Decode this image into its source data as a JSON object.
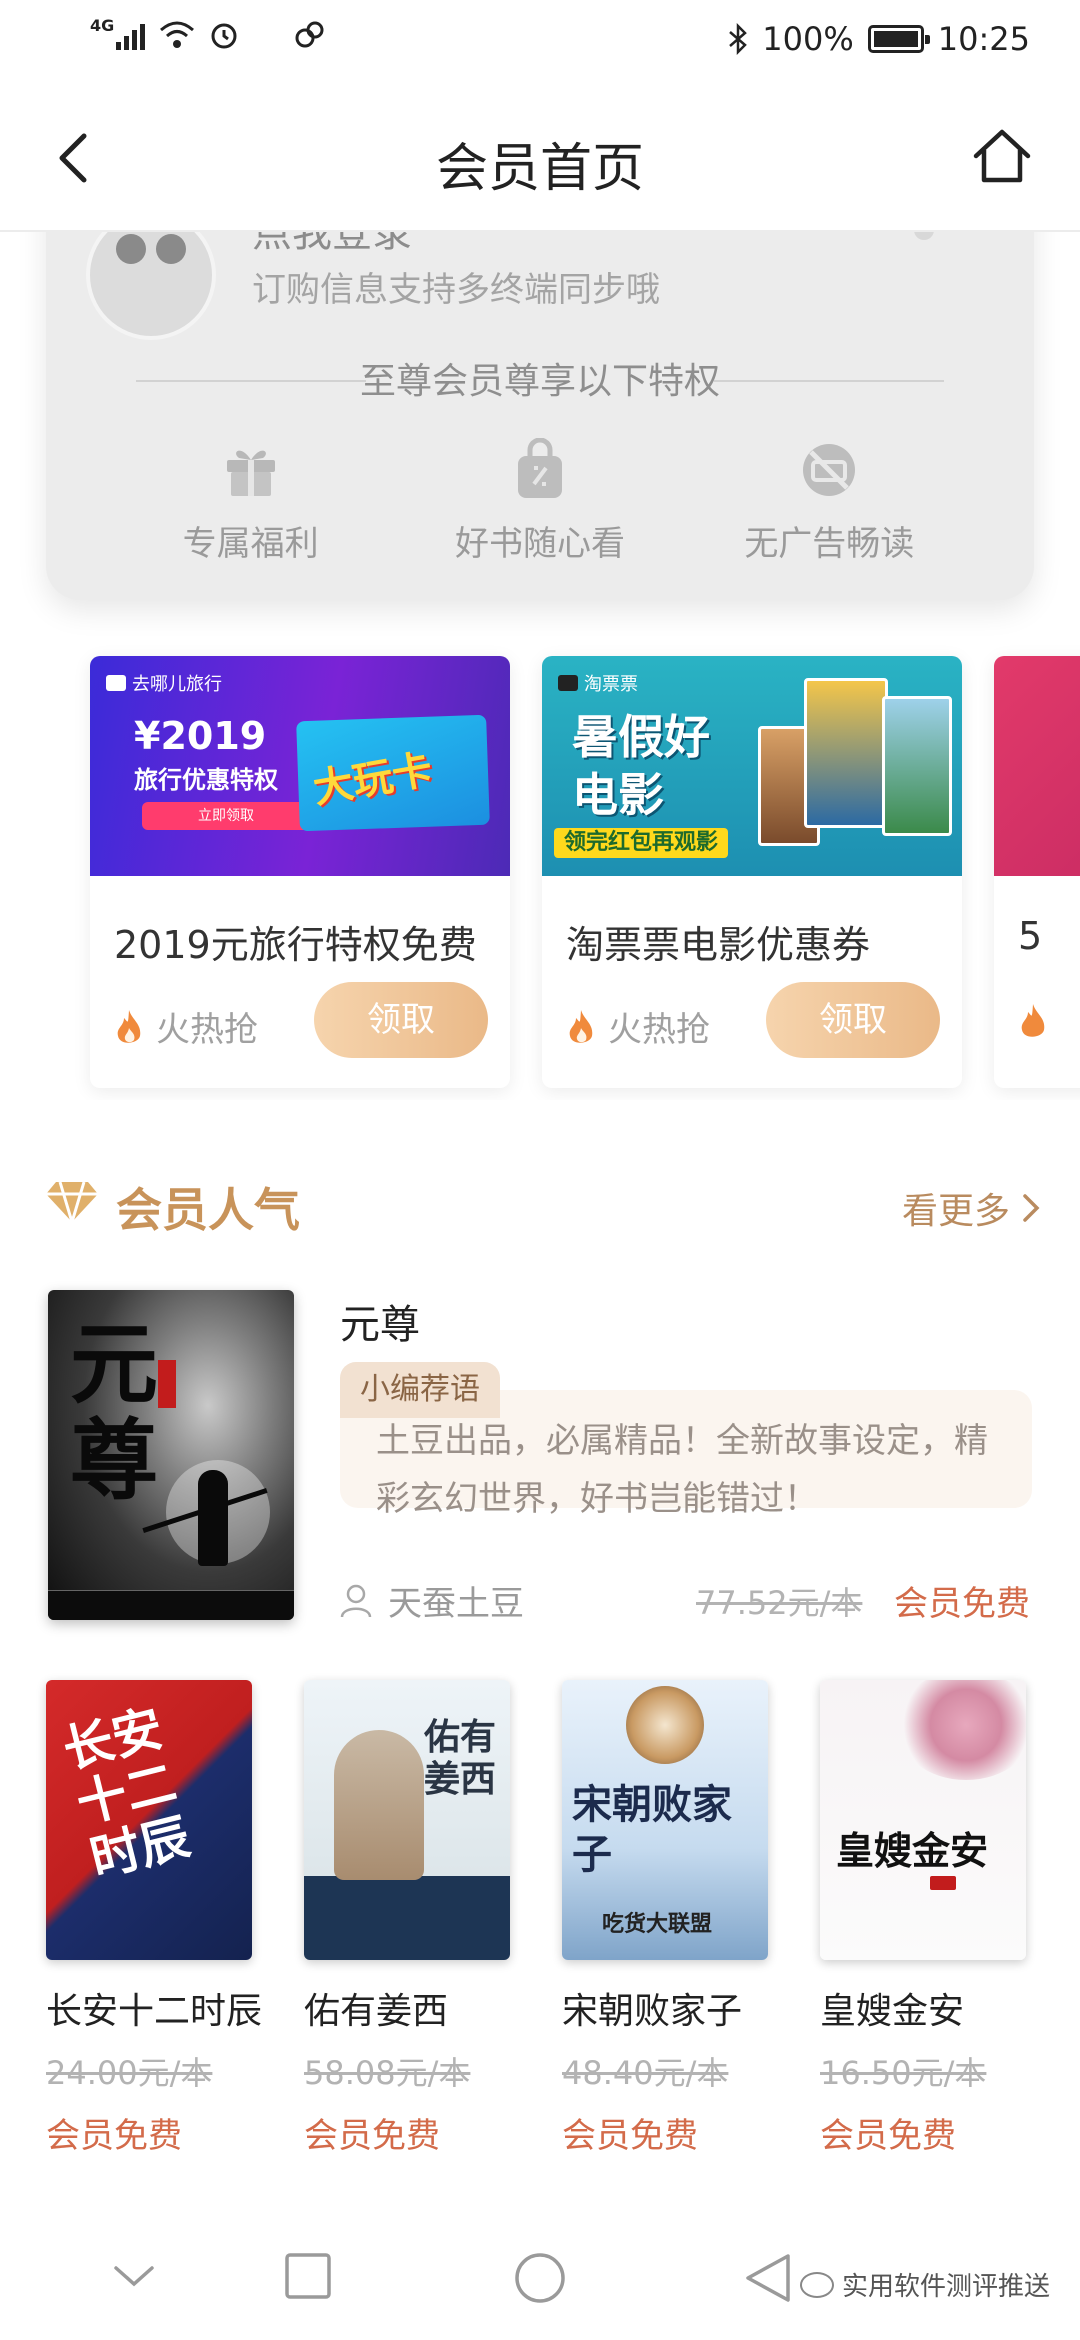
{
  "status_bar": {
    "network": "4G",
    "battery": "100%",
    "time": "10:25"
  },
  "nav": {
    "title": "会员首页"
  },
  "member_card": {
    "name": "点我登录",
    "subtitle": "订购信息支持多终端同步哦",
    "privileges_title": "至尊会员尊享以下特权",
    "privileges": [
      {
        "icon": "gift-icon",
        "label": "专属福利"
      },
      {
        "icon": "book-bag-icon",
        "label": "好书随心看"
      },
      {
        "icon": "no-ads-icon",
        "label": "无广告畅读"
      }
    ]
  },
  "coupons": [
    {
      "title": "2019元旅行特权免费",
      "hot_label": "火热抢",
      "button": "领取",
      "banner": {
        "brand": "去哪儿旅行",
        "headline": "¥2019",
        "subline": "旅行优惠特权",
        "cta": "立即领取",
        "card_text": "大玩卡"
      }
    },
    {
      "title": "淘票票电影优惠券",
      "hot_label": "火热抢",
      "button": "领取",
      "banner": {
        "brand": "淘票票",
        "headline": "暑假好电影",
        "tag": "领完红包再观影"
      }
    },
    {
      "title": "5",
      "hot_label": "",
      "button": ""
    }
  ],
  "section": {
    "title": "会员人气",
    "more": "看更多"
  },
  "featured": {
    "title": "元尊",
    "tag": "小编荐语",
    "recommendation": "土豆出品，必属精品！全新故事设定，精彩玄幻世界，好书岂能错过！",
    "author": "天蚕土豆",
    "price": "77.52元/本",
    "free_label": "会员免费",
    "cover_text": "元尊"
  },
  "books": [
    {
      "title": "长安十二时辰",
      "price": "24.00元/本",
      "free_label": "会员免费",
      "cover_text": "长安十二时辰"
    },
    {
      "title": "佑有姜西",
      "price": "58.08元/本",
      "free_label": "会员免费",
      "cover_text": "佑有姜西"
    },
    {
      "title": "宋朝败家子",
      "price": "48.40元/本",
      "free_label": "会员免费",
      "cover_text": "宋朝败家子",
      "cover_sub": "吃货大联盟"
    },
    {
      "title": "皇嫂金安",
      "price": "16.50元/本",
      "free_label": "会员免费",
      "cover_text": "皇嫂金安"
    }
  ],
  "watermark": "实用软件测评推送",
  "colors": {
    "accent_gold": "#c8935a",
    "free_red": "#d36b4a",
    "button_gold": "#eab988"
  }
}
